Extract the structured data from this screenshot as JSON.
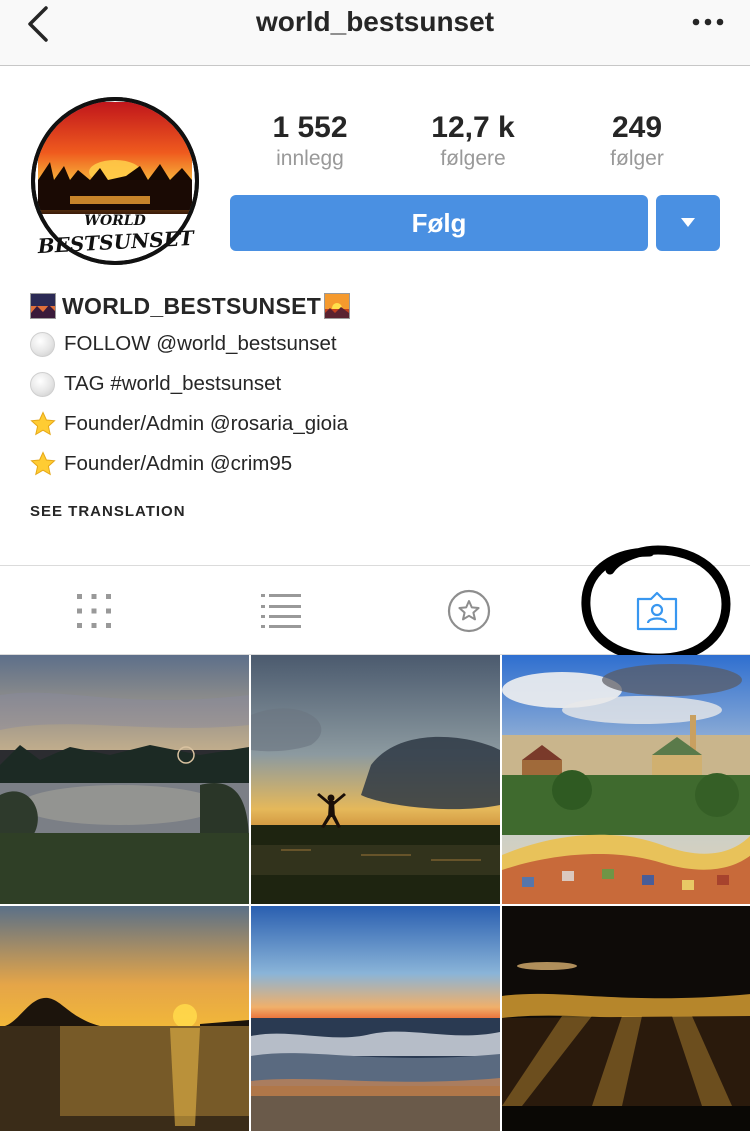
{
  "nav": {
    "title": "world_bestsunset",
    "back_icon": "chevron-left-icon",
    "more_icon": "ellipsis-icon"
  },
  "profile": {
    "avatar_text_top": "WORLD",
    "avatar_text_bottom": "BESTSUNSET",
    "stats": [
      {
        "value": "1 552",
        "label": "innlegg"
      },
      {
        "value": "12,7 k",
        "label": "følgere"
      },
      {
        "value": "249",
        "label": "følger"
      }
    ],
    "follow_label": "Følg",
    "dropdown_icon": "triangle-down-icon"
  },
  "bio": {
    "name": "WORLD_BESTSUNSET",
    "lines": [
      {
        "icon": "white-circle-icon",
        "text": "FOLLOW @world_bestsunset"
      },
      {
        "icon": "white-circle-icon",
        "text": "TAG #world_bestsunset"
      },
      {
        "icon": "star-icon",
        "text": "Founder/Admin @rosaria_gioia"
      },
      {
        "icon": "star-icon",
        "text": "Founder/Admin @crim95"
      }
    ],
    "see_translation": "SEE TRANSLATION"
  },
  "tabs": [
    {
      "icon": "grid-icon",
      "active": false
    },
    {
      "icon": "list-icon",
      "active": false
    },
    {
      "icon": "star-circle-icon",
      "active": false
    },
    {
      "icon": "tagged-person-icon",
      "active": true
    }
  ],
  "colors": {
    "accent": "#4a90e2",
    "text": "#262626",
    "muted": "#999999",
    "tab_active": "#3897f0",
    "annotation": "#000000"
  },
  "photos": [
    {
      "subject": "lake with ferris wheel at sunset"
    },
    {
      "subject": "person jumping silhouette at sunset"
    },
    {
      "subject": "park guell mosaic city view"
    },
    {
      "subject": "island silhouette golden sunset sea"
    },
    {
      "subject": "beach waves at dusk"
    },
    {
      "subject": "sun rays through dark clouds"
    }
  ]
}
